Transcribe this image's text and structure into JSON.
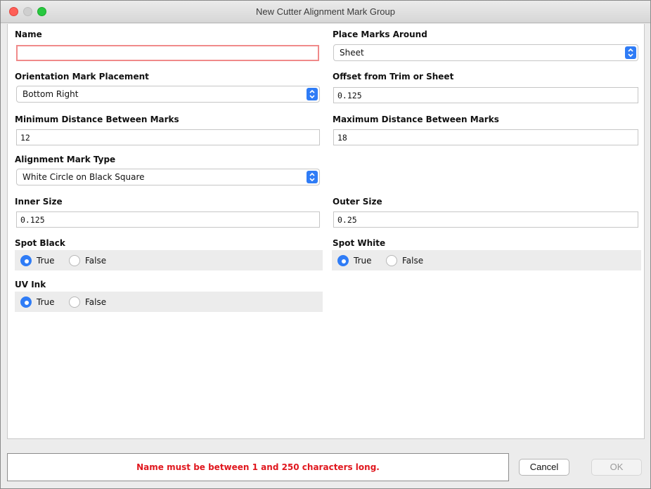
{
  "window": {
    "title": "New Cutter Alignment Mark Group"
  },
  "form": {
    "name": {
      "label": "Name",
      "value": ""
    },
    "place_marks_around": {
      "label": "Place Marks Around",
      "value": "Sheet"
    },
    "orientation_mark_placement": {
      "label": "Orientation Mark Placement",
      "value": "Bottom Right"
    },
    "offset": {
      "label": "Offset from Trim or Sheet",
      "value": "0.125"
    },
    "min_distance": {
      "label": "Minimum Distance Between Marks",
      "value": "12"
    },
    "max_distance": {
      "label": "Maximum Distance Between Marks",
      "value": "18"
    },
    "alignment_mark_type": {
      "label": "Alignment Mark Type",
      "value": "White Circle on Black Square"
    },
    "inner_size": {
      "label": "Inner Size",
      "value": "0.125"
    },
    "outer_size": {
      "label": "Outer Size",
      "value": "0.25"
    },
    "spot_black": {
      "label": "Spot Black",
      "true_label": "True",
      "false_label": "False",
      "selected": "True"
    },
    "spot_white": {
      "label": "Spot White",
      "true_label": "True",
      "false_label": "False",
      "selected": "True"
    },
    "uv_ink": {
      "label": "UV Ink",
      "true_label": "True",
      "false_label": "False",
      "selected": "True"
    }
  },
  "footer": {
    "status_message": "Name must be between 1 and 250 characters long.",
    "cancel_label": "Cancel",
    "ok_label": "OK"
  },
  "colors": {
    "accent": "#2f7cf6",
    "error_text": "#e0171e",
    "error_border": "#f08a8a"
  },
  "icons": {
    "select_arrows": "updown-chevrons-icon"
  }
}
